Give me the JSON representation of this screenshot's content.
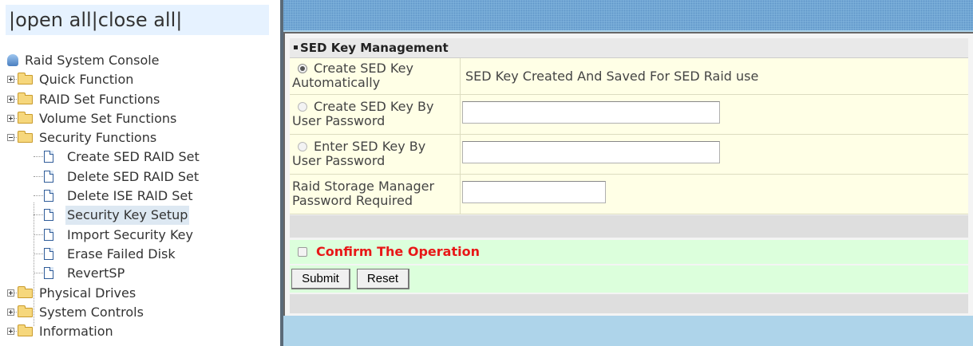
{
  "tree_header": {
    "open_all": "open all",
    "close_all": "close all",
    "separator": "|"
  },
  "tree": {
    "root": "Raid System Console",
    "items": [
      {
        "label": "Quick Function"
      },
      {
        "label": "RAID Set Functions"
      },
      {
        "label": "Volume Set Functions"
      },
      {
        "label": "Security Functions",
        "children": [
          "Create SED RAID Set",
          "Delete SED RAID Set",
          "Delete ISE RAID Set",
          "Security Key Setup",
          "Import Security Key",
          "Erase Failed Disk",
          "RevertSP"
        ]
      },
      {
        "label": "Physical Drives"
      },
      {
        "label": "System Controls"
      },
      {
        "label": "Information"
      }
    ],
    "selected": "Security Key Setup"
  },
  "panel": {
    "title": "SED Key Management",
    "options": [
      {
        "label_line1": "Create SED Key",
        "label_line2": "Automatically",
        "value": "SED Key Created And Saved For SED Raid use",
        "checked": true
      },
      {
        "label_line1": "Create SED Key By",
        "label_line2": "User Password",
        "input_value": ""
      },
      {
        "label_line1": "Enter SED Key By",
        "label_line2": "User Password",
        "input_value": ""
      }
    ],
    "password_required": {
      "label_line1": "Raid Storage Manager",
      "label_line2": "Password Required",
      "input_value": ""
    },
    "confirm_label": "Confirm The Operation",
    "submit_label": "Submit",
    "reset_label": "Reset"
  },
  "colors": {
    "confirm_text": "#e81717",
    "form_bg": "#ffffe6",
    "confirm_bg": "#dcffdc",
    "right_bg": "#aed4ea"
  }
}
